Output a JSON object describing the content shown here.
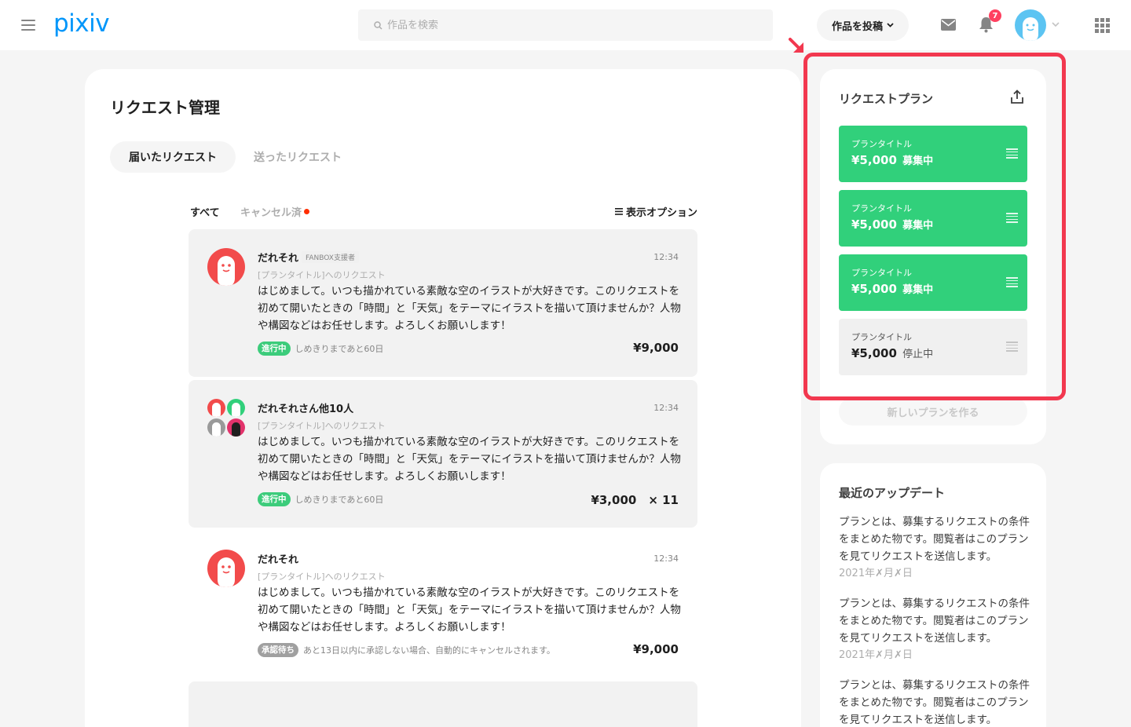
{
  "header": {
    "logo": "pixiv",
    "search_placeholder": "作品を検索",
    "post_button": "作品を投稿",
    "notification_count": "7"
  },
  "main": {
    "title": "リクエスト管理",
    "tabs": [
      {
        "label": "届いたリクエスト"
      },
      {
        "label": "送ったリクエスト"
      }
    ],
    "filters": {
      "all": "すべて",
      "cancelled": "キャンセル済",
      "display_options": "表示オプション"
    },
    "requests": [
      {
        "name": "だれそれ",
        "tag": "FANBOX支援者",
        "time": "12:34",
        "plan_ref": "[プランタイトル]へのリクエスト",
        "body": "はじめまして。いつも描かれている素敵な空のイラストが大好きです。このリクエストを初めて開いたときの「時間」と「天気」をテーマにイラストを描いて頂けませんか？人物や構図などはお任せします。よろしくお願いします！",
        "status": "進行中",
        "note": "しめきりまであと60日",
        "price": "¥9,000"
      },
      {
        "name": "だれそれさん他10人",
        "time": "12:34",
        "plan_ref": "[プランタイトル]へのリクエスト",
        "body": "はじめまして。いつも描かれている素敵な空のイラストが大好きです。このリクエストを初めて開いたときの「時間」と「天気」をテーマにイラストを描いて頂けませんか？人物や構図などはお任せします。よろしくお願いします！",
        "status": "進行中",
        "note": "しめきりまであと60日",
        "price": "¥3,000　× 11"
      },
      {
        "name": "だれそれ",
        "time": "12:34",
        "plan_ref": "[プランタイトル]へのリクエスト",
        "body": "はじめまして。いつも描かれている素敵な空のイラストが大好きです。このリクエストを初めて開いたときの「時間」と「天気」をテーマにイラストを描いて頂けませんか？人物や構図などはお任せします。よろしくお願いします！",
        "status": "承認待ち",
        "note": "あと13日以内に承認しない場合、自動的にキャンセルされます。",
        "price": "¥9,000"
      }
    ]
  },
  "sidebar": {
    "plans_title": "リクエストプラン",
    "plans": [
      {
        "title": "プランタイトル",
        "price": "¥5,000",
        "state": "募集中"
      },
      {
        "title": "プランタイトル",
        "price": "¥5,000",
        "state": "募集中"
      },
      {
        "title": "プランタイトル",
        "price": "¥5,000",
        "state": "募集中"
      },
      {
        "title": "プランタイトル",
        "price": "¥5,000",
        "state": "停止中"
      }
    ],
    "new_plan": "新しいプランを作る",
    "updates_title": "最近のアップデート",
    "updates": [
      {
        "text": "プランとは、募集するリクエストの条件をまとめた物です。閲覧者はこのプランを見てリクエストを送信します。",
        "date": "2021年✗月✗日"
      },
      {
        "text": "プランとは、募集するリクエストの条件をまとめた物です。閲覧者はこのプランを見てリクエストを送信します。",
        "date": "2021年✗月✗日"
      },
      {
        "text": "プランとは、募集するリクエストの条件をまとめた物です。閲覧者はこのプランを見てリクエストを送信します。",
        "date": ""
      }
    ]
  },
  "colors": {
    "brand": "#0096fa",
    "active_plan": "#31d07b",
    "status_green": "#3ccc7b",
    "highlight": "#f2384f"
  }
}
